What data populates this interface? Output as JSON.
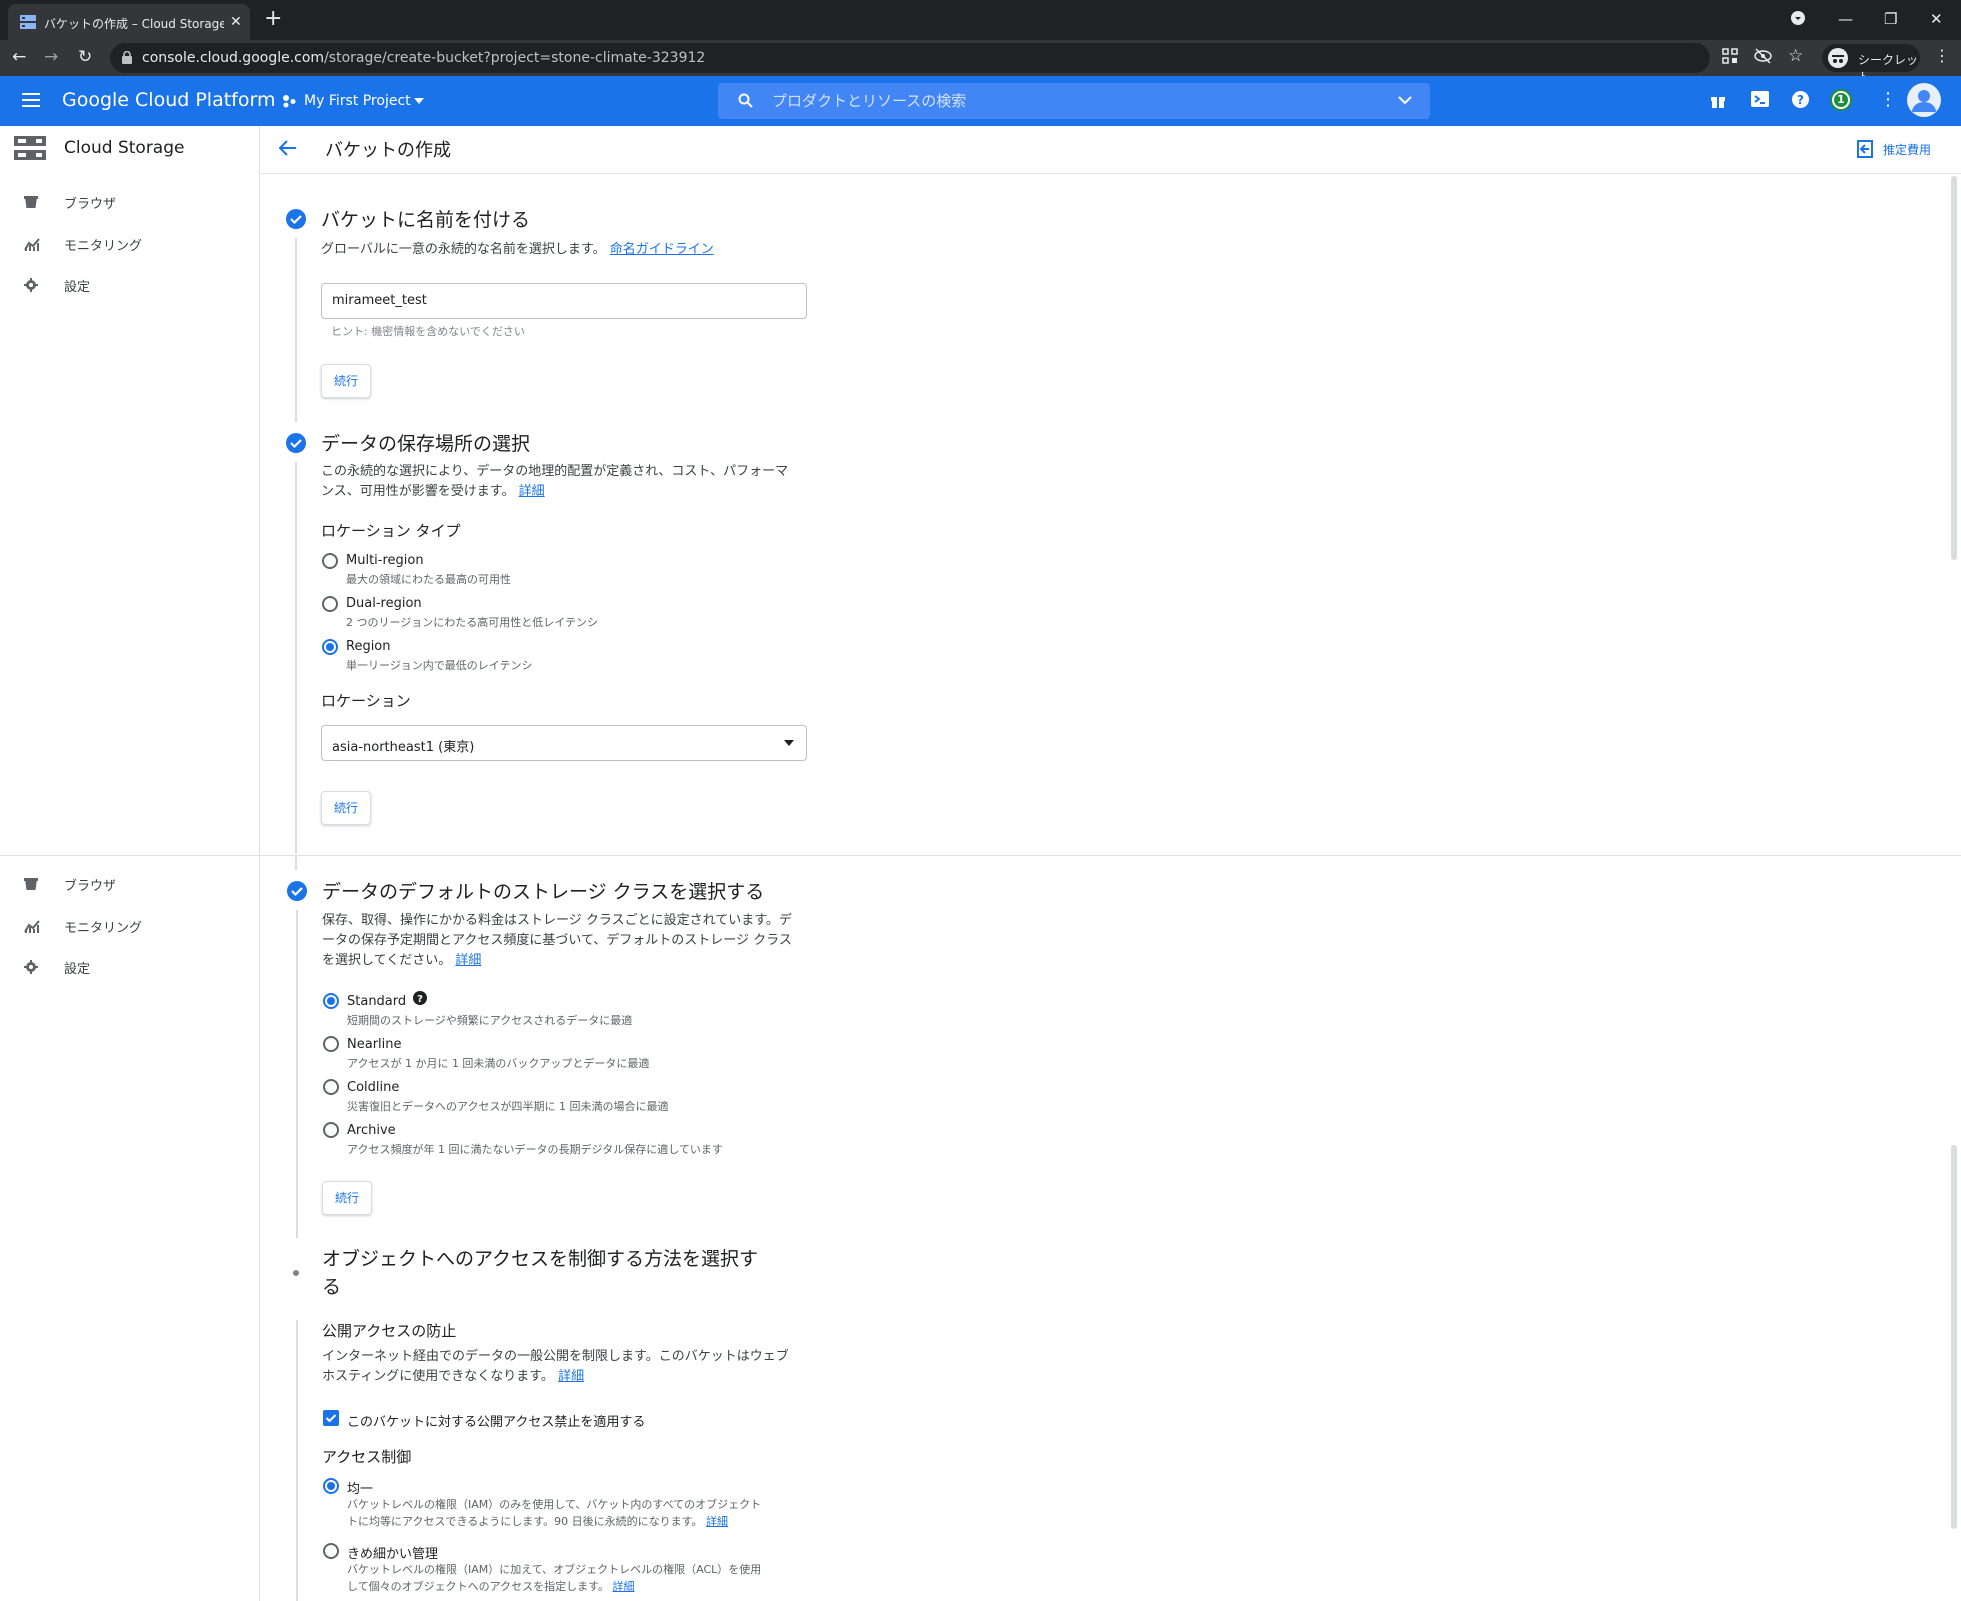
{
  "browser": {
    "tab_title": "バケットの作成 – Cloud Storage – My First Project",
    "url_host": "console.cloud.google.com",
    "url_path": "/storage/create-bucket?project=stone-climate-323912",
    "incognito_label": "シークレット"
  },
  "gcp": {
    "brand": "Google Cloud Platform",
    "project": "My First Project",
    "search_placeholder": "プロダクトとリソースの検索",
    "notification_count": "1"
  },
  "sidebar": {
    "product": "Cloud Storage",
    "items": [
      {
        "label": "ブラウザ",
        "icon": "bucket-icon"
      },
      {
        "label": "モニタリング",
        "icon": "chart-icon"
      },
      {
        "label": "設定",
        "icon": "gear-icon"
      }
    ],
    "items_repeat": [
      {
        "label": "ブラウザ"
      },
      {
        "label": "モニタリング"
      },
      {
        "label": "設定"
      }
    ]
  },
  "page": {
    "title": "バケットの作成",
    "cost_label": "推定費用"
  },
  "step1": {
    "title": "バケットに名前を付ける",
    "desc": "グローバルに一意の永続的な名前を選択します。",
    "link": "命名ガイドライン",
    "bucket_name": "mirameet_test",
    "hint": "ヒント: 機密情報を含めないでください",
    "continue": "続行"
  },
  "step2": {
    "title": "データの保存場所の選択",
    "desc_line1": "この永続的な選択により、データの地理的配置が定義され、コスト、パフォーマ",
    "desc_line2": "ンス、可用性が影響を受けます。",
    "link": "詳細",
    "location_type_label": "ロケーション タイプ",
    "options": [
      {
        "label": "Multi-region",
        "sub": "最大の領域にわたる最高の可用性",
        "selected": false
      },
      {
        "label": "Dual-region",
        "sub": "2 つのリージョンにわたる高可用性と低レイテンシ",
        "selected": false
      },
      {
        "label": "Region",
        "sub": "単一リージョン内で最低のレイテンシ",
        "selected": true
      }
    ],
    "location_label": "ロケーション",
    "location_value": "asia-northeast1 (東京)",
    "continue": "続行"
  },
  "step3": {
    "title": "データのデフォルトのストレージ クラスを選択する",
    "desc_line1": "保存、取得、操作にかかる料金はストレージ クラスごとに設定されています。デ",
    "desc_line2": "ータの保存予定期間とアクセス頻度に基づいて、デフォルトのストレージ クラス",
    "desc_line3": "を選択してください。",
    "link": "詳細",
    "options": [
      {
        "label": "Standard",
        "sub": "短期間のストレージや頻繁にアクセスされるデータに最適",
        "selected": true
      },
      {
        "label": "Nearline",
        "sub": "アクセスが 1 か月に 1 回未満のバックアップとデータに最適",
        "selected": false
      },
      {
        "label": "Coldline",
        "sub": "災害復旧とデータへのアクセスが四半期に 1 回未満の場合に最適",
        "selected": false
      },
      {
        "label": "Archive",
        "sub": "アクセス頻度が年 1 回に満たないデータの長期デジタル保存に適しています",
        "selected": false
      }
    ],
    "continue": "続行"
  },
  "step4": {
    "title_line1": "オブジェクトへのアクセスを制御する方法を選択す",
    "title_line2": "る",
    "public_h": "公開アクセスの防止",
    "public_desc_line1": "インターネット経由でのデータの一般公開を制限します。このバケットはウェブ",
    "public_desc_line2": "ホスティングに使用できなくなります。",
    "link": "詳細",
    "checkbox_label": "このバケットに対する公開アクセス禁止を適用する",
    "access_h": "アクセス制御",
    "uniform_label": "均一",
    "uniform_sub1": "バケットレベルの権限（IAM）のみを使用して、バケット内のすべてのオブジェクト",
    "uniform_sub2": "トに均等にアクセスできるようにします。90 日後に永続的になります。",
    "fine_label": "きめ細かい管理",
    "fine_sub1": "バケットレベルの権限（IAM）に加えて、オブジェクトレベルの権限（ACL）を使用",
    "fine_sub2": "して個々のオブジェクトへのアクセスを指定します。"
  }
}
